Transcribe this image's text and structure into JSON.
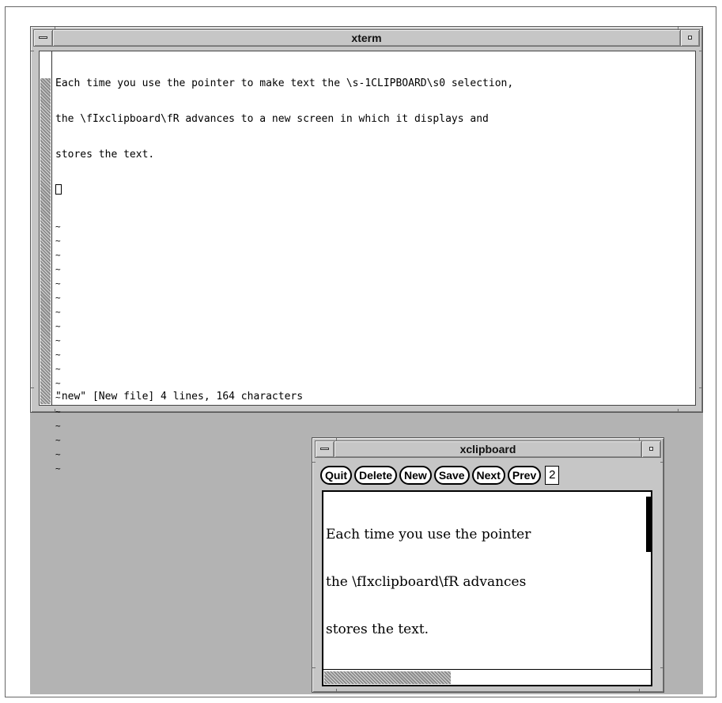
{
  "xterm": {
    "title": "xterm",
    "lines": [
      "Each time you use the pointer to make text the \\s-1CLIPBOARD\\s0 selection,",
      "the \\fIxclipboard\\fR advances to a new screen in which it displays and",
      "stores the text."
    ],
    "tilde": "~",
    "tilde_count": 18,
    "status_line": "\"new\" [New file] 4 lines, 164 characters"
  },
  "xclipboard": {
    "title": "xclipboard",
    "buttons": {
      "quit": "Quit",
      "delete": "Delete",
      "new": "New",
      "save": "Save",
      "next": "Next",
      "prev": "Prev"
    },
    "page_number": "2",
    "text_lines": [
      "Each time you use the pointer",
      "the \\fIxclipboard\\fR advances",
      "stores the text."
    ]
  },
  "icons": {
    "window_menu": "window-menu-icon",
    "minimize": "minimize-icon"
  }
}
